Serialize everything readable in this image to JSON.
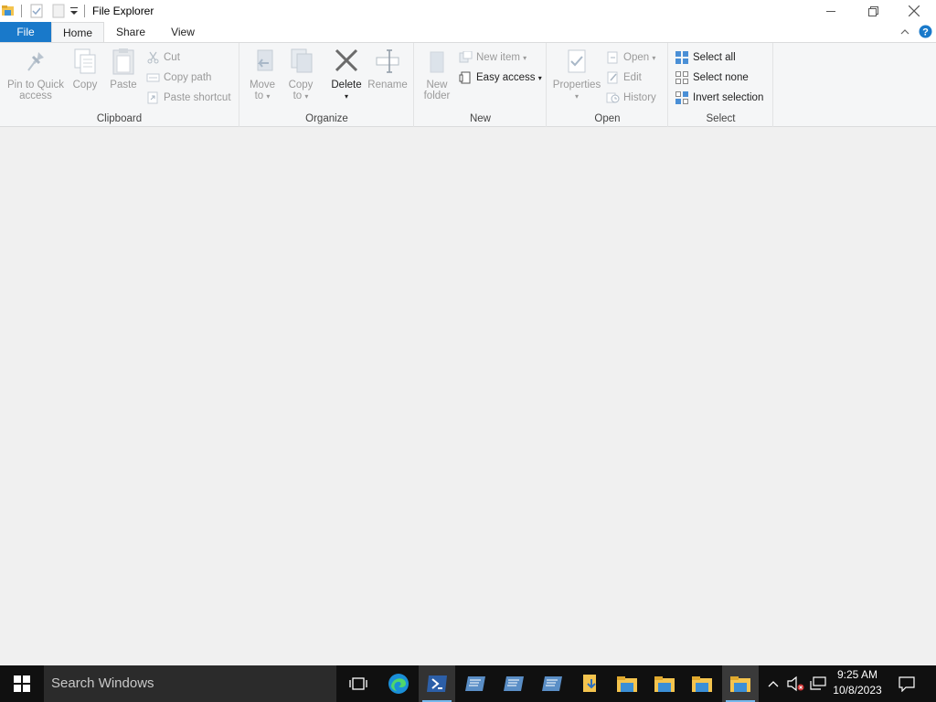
{
  "window": {
    "title": "File Explorer"
  },
  "tabs": [
    {
      "label": "File"
    },
    {
      "label": "Home"
    },
    {
      "label": "Share"
    },
    {
      "label": "View"
    }
  ],
  "ribbon": {
    "clipboard": {
      "pin_label_1": "Pin to Quick",
      "pin_label_2": "access",
      "copy": "Copy",
      "paste": "Paste",
      "cut": "Cut",
      "copy_path": "Copy path",
      "paste_shortcut": "Paste shortcut",
      "group": "Clipboard"
    },
    "organize": {
      "move_to_1": "Move",
      "move_to_2": "to",
      "copy_to_1": "Copy",
      "copy_to_2": "to",
      "delete": "Delete",
      "rename": "Rename",
      "group": "Organize"
    },
    "new": {
      "new_folder_1": "New",
      "new_folder_2": "folder",
      "new_item": "New item",
      "easy_access": "Easy access",
      "group": "New"
    },
    "open": {
      "properties": "Properties",
      "open": "Open",
      "edit": "Edit",
      "history": "History",
      "group": "Open"
    },
    "select": {
      "select_all": "Select all",
      "select_none": "Select none",
      "invert_selection": "Invert selection",
      "group": "Select"
    }
  },
  "taskbar": {
    "search_placeholder": "Search Windows",
    "time": "9:25 AM",
    "date": "10/8/2023"
  },
  "colors": {
    "accent": "#1979ca",
    "taskbar": "#101010"
  }
}
